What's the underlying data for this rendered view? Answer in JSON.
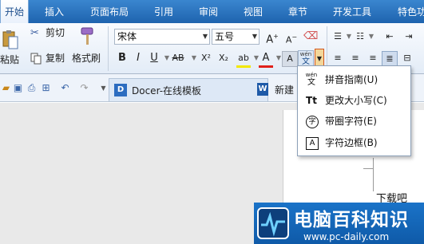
{
  "tabs": [
    "开始",
    "插入",
    "页面布局",
    "引用",
    "审阅",
    "视图",
    "章节",
    "开发工具",
    "特色功"
  ],
  "clipboard": {
    "paste_label": "粘贴",
    "cut_label": "剪切",
    "copy_label": "复制",
    "format_painter_label": "格式刷"
  },
  "font": {
    "name": "宋体",
    "size": "五号"
  },
  "format_buttons": [
    "B",
    "I",
    "U",
    "AB",
    "X²",
    "X₂"
  ],
  "doc_tabs": {
    "docer_label": "Docer-在线模板",
    "new_label": "新建"
  },
  "phonetic_glyph": {
    "top": "wén",
    "bottom": "文"
  },
  "menu": {
    "items": [
      {
        "label": "拼音指南(U)",
        "icon": "pinyin-guide-icon"
      },
      {
        "label": "更改大小写(C)",
        "icon": "change-case-icon"
      },
      {
        "label": "带圈字符(E)",
        "icon": "enclosed-character-icon"
      },
      {
        "label": "字符边框(B)",
        "icon": "character-border-icon"
      }
    ],
    "icon_glyphs": {
      "pinyin_top": "wén",
      "pinyin_bottom": "文",
      "case_glyph": "Tt",
      "enclosed_glyph": "字",
      "border_glyph": "A"
    }
  },
  "document": {
    "text": "下载吧"
  },
  "watermark": {
    "main": "电脑百科知识",
    "url": "www.pc-daily.com"
  },
  "colors": {
    "accent": "#1e63ae",
    "ribbon": "#e3ecf7",
    "highlight": "#f3d79a"
  }
}
